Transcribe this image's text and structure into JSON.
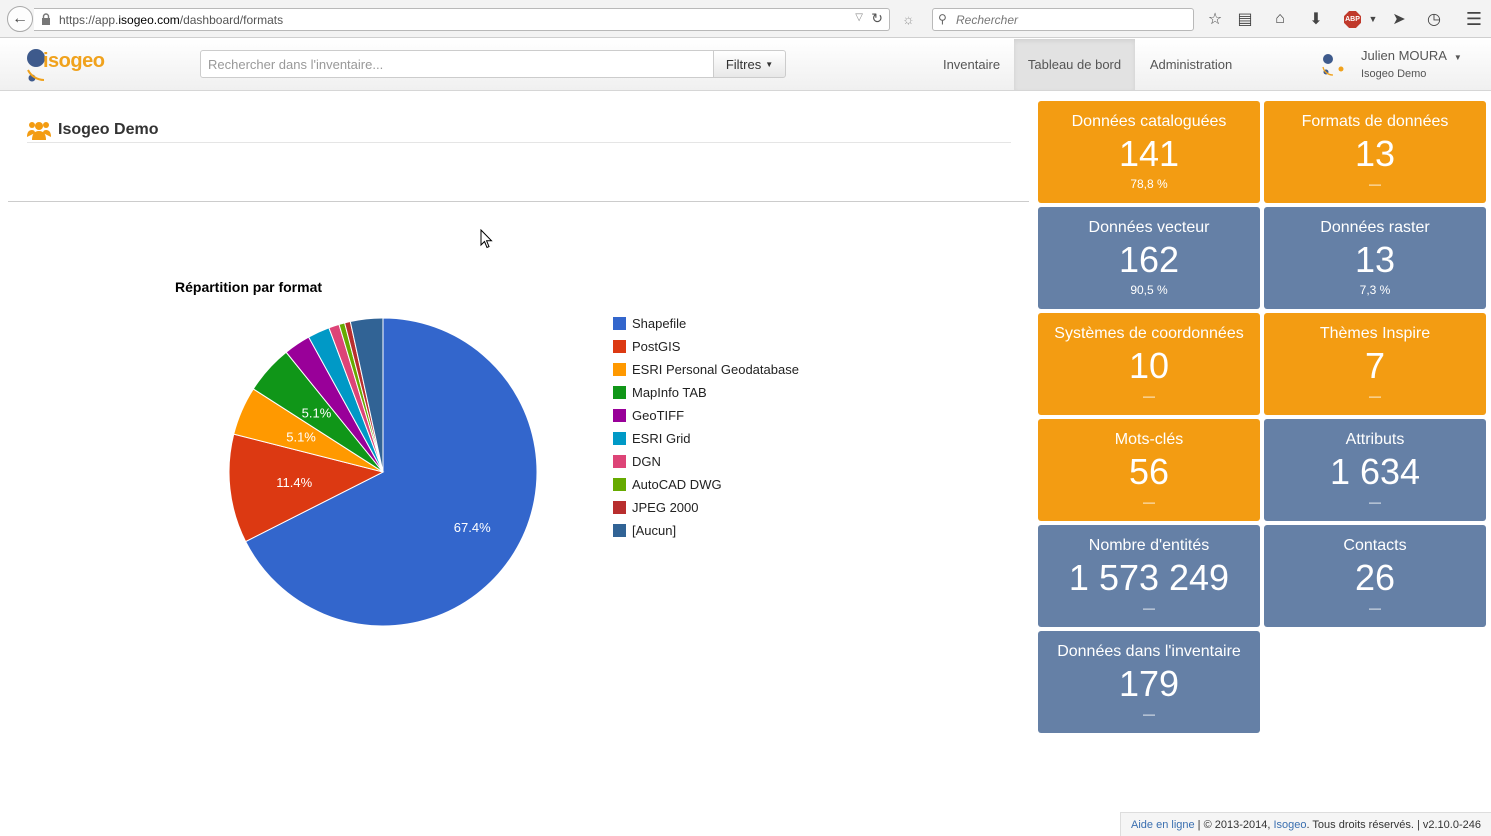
{
  "browser": {
    "url_prefix": "https://app.",
    "url_domain": "isogeo.com",
    "url_path": "/dashboard/formats",
    "search_placeholder": "Rechercher"
  },
  "header": {
    "logo_text": "isogeo",
    "search_placeholder": "Rechercher dans l'inventaire...",
    "filter_label": "Filtres",
    "nav": [
      "Inventaire",
      "Tableau de bord",
      "Administration"
    ],
    "active_nav": "Tableau de bord",
    "user_name": "Julien MOURA",
    "user_org": "Isogeo Demo"
  },
  "main": {
    "org_title": "Isogeo Demo"
  },
  "chart_data": {
    "type": "pie",
    "title": "Répartition par format",
    "categories": [
      "Shapefile",
      "PostGIS",
      "ESRI Personal Geodatabase",
      "MapInfo TAB",
      "GeoTIFF",
      "ESRI Grid",
      "DGN",
      "AutoCAD DWG",
      "JPEG 2000",
      "[Aucun]"
    ],
    "values": [
      67.4,
      11.4,
      5.1,
      5.1,
      2.8,
      2.3,
      1.1,
      0.6,
      0.6,
      3.4
    ],
    "colors": [
      "#3366cc",
      "#dc3912",
      "#ff9900",
      "#109618",
      "#990099",
      "#0099c6",
      "#dd4477",
      "#66aa00",
      "#b82e2e",
      "#316395"
    ],
    "slice_labels": [
      "67.4%",
      "11.4%",
      "5.1%",
      "5.1%"
    ],
    "legend_position": "right"
  },
  "tiles": [
    {
      "label": "Données cataloguées",
      "value": "141",
      "sub": "78,8 %",
      "color": "orange"
    },
    {
      "label": "Formats de données",
      "value": "13",
      "sub": "—",
      "color": "orange"
    },
    {
      "label": "Données vecteur",
      "value": "162",
      "sub": "90,5 %",
      "color": "blue"
    },
    {
      "label": "Données raster",
      "value": "13",
      "sub": "7,3 %",
      "color": "blue"
    },
    {
      "label": "Systèmes de coordonnées",
      "value": "10",
      "sub": "—",
      "color": "orange"
    },
    {
      "label": "Thèmes Inspire",
      "value": "7",
      "sub": "—",
      "color": "orange"
    },
    {
      "label": "Mots-clés",
      "value": "56",
      "sub": "—",
      "color": "orange"
    },
    {
      "label": "Attributs",
      "value": "1 634",
      "sub": "—",
      "color": "blue"
    },
    {
      "label": "Nombre d'entités",
      "value": "1 573 249",
      "sub": "—",
      "color": "blue"
    },
    {
      "label": "Contacts",
      "value": "26",
      "sub": "—",
      "color": "blue"
    },
    {
      "label": "Données dans l'inventaire",
      "value": "179",
      "sub": "—",
      "color": "blue"
    }
  ],
  "footer": {
    "help_link": "Aide en ligne",
    "sep1": " | © 2013-2014, ",
    "company_link": "Isogeo",
    "rights": ". Tous droits réservés. | v2.10.0-246"
  }
}
